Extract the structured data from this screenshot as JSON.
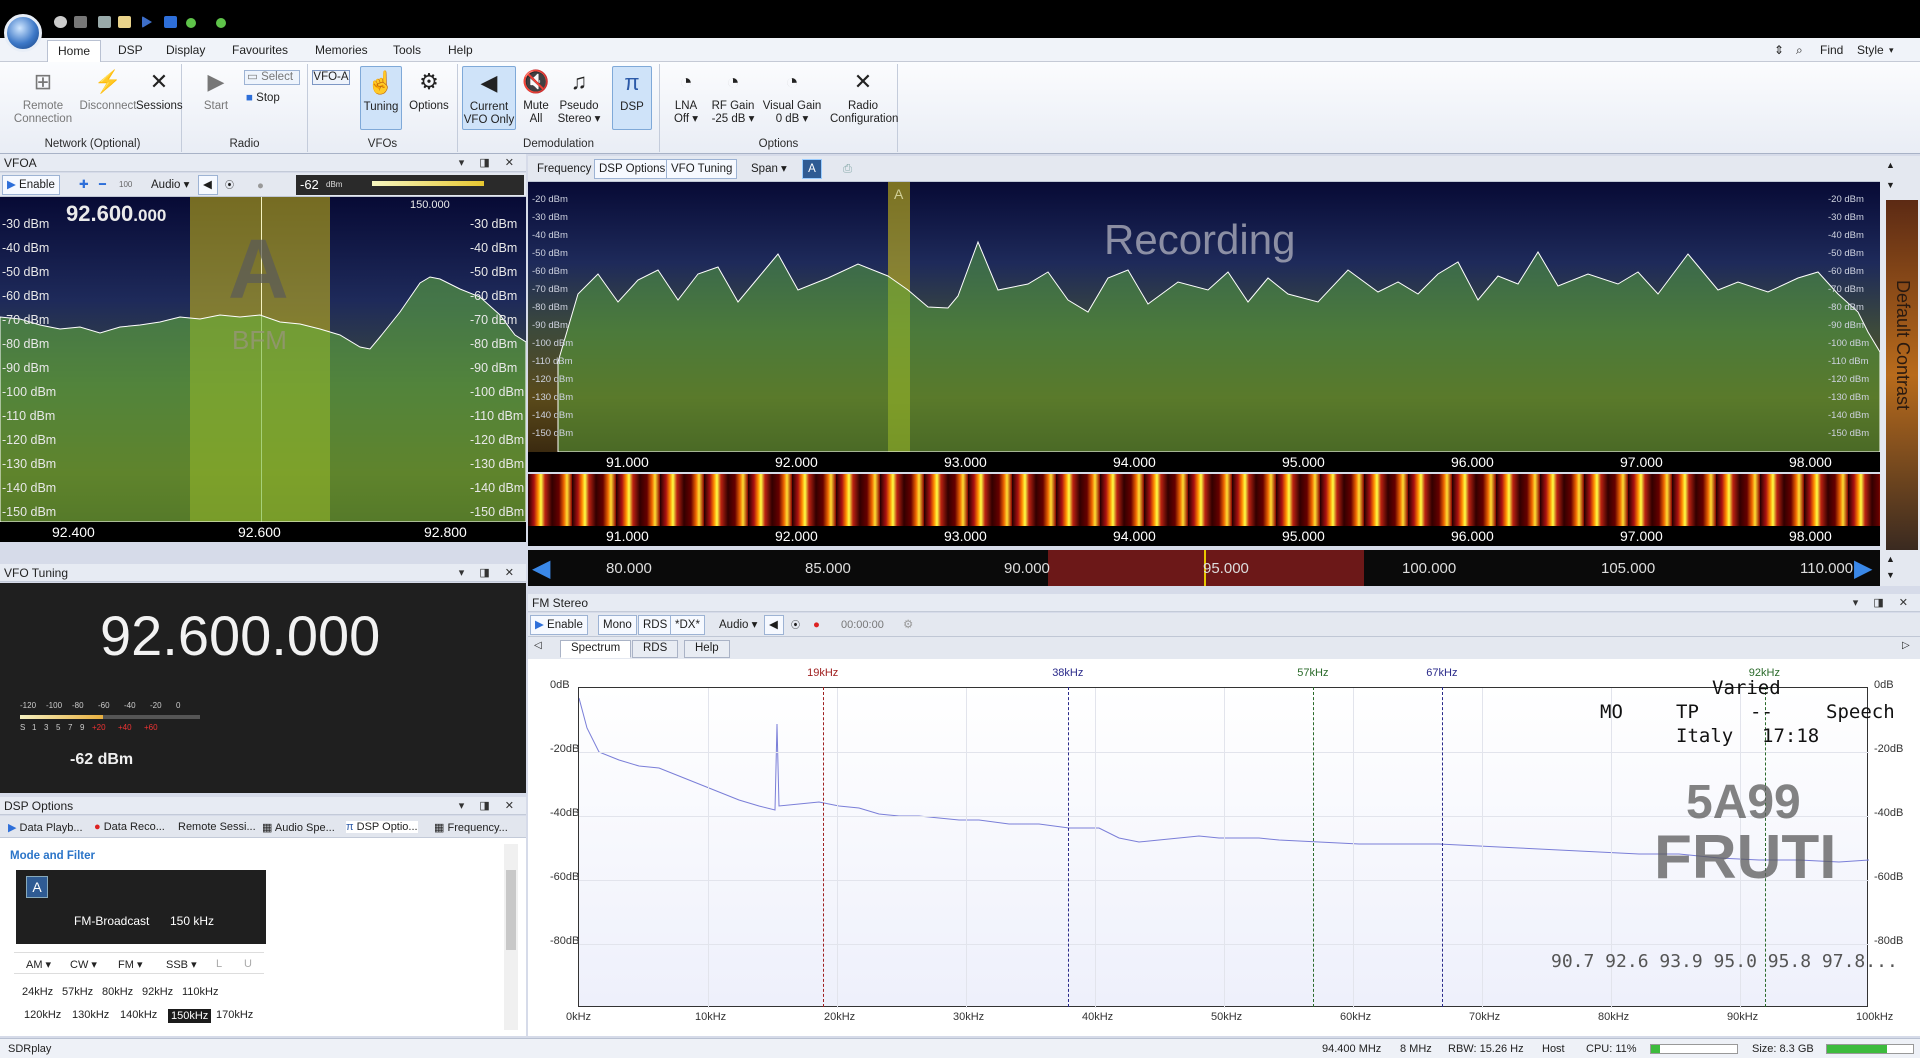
{
  "app": {
    "status_left": "SDRplay"
  },
  "menu": {
    "tabs": [
      "Home",
      "DSP",
      "Display",
      "Favourites",
      "Memories",
      "Tools",
      "Help"
    ],
    "right": {
      "find": "Find",
      "style": "Style"
    }
  },
  "ribbon": {
    "groups": {
      "network": {
        "label": "Network (Optional)",
        "remote": "Remote\nConnection",
        "disconnect": "Disconnect",
        "sessions": "Sessions"
      },
      "radio": {
        "label": "Radio",
        "start": "Start",
        "select": "Select",
        "stop": "Stop"
      },
      "vfos": {
        "label": "VFOs",
        "vfoa": "VFO-A",
        "tuning": "Tuning",
        "options": "Options"
      },
      "demodulation": {
        "label": "Demodulation",
        "current_vfo": "Current\nVFO Only",
        "mute_all": "Mute\nAll",
        "pseudo_stereo": "Pseudo\nStereo ▾",
        "dsp": "DSP"
      },
      "options": {
        "label": "Options",
        "lna": "LNA\nOff ▾",
        "rf_gain": "RF Gain\n-25 dB ▾",
        "visual_gain": "Visual Gain\n0 dB ▾",
        "radio_config": "Radio\nConfiguration"
      }
    }
  },
  "vfoa_panel": {
    "title": "VFOA",
    "enable": "Enable",
    "audio": "Audio",
    "step": "100",
    "meter_value": "-62",
    "meter_unit": "dBm",
    "bandwidth": "150.000",
    "frequency_big": "92.600",
    "frequency_small": ".000",
    "vfo_letter": "A",
    "mode": "BFM",
    "db_labels": [
      "-30 dBm",
      "-40 dBm",
      "-50 dBm",
      "-60 dBm",
      "-70 dBm",
      "-80 dBm",
      "-90 dBm",
      "-100 dBm",
      "-110 dBm",
      "-120 dBm",
      "-130 dBm",
      "-140 dBm",
      "-150 dBm"
    ],
    "freq_axis": [
      "92.400",
      "92.600",
      "92.800"
    ]
  },
  "vfo_tuning": {
    "title": "VFO Tuning",
    "frequency": "92.600.000",
    "scale_top": [
      "-120",
      "-100",
      "-80",
      "-60",
      "-40",
      "-20",
      "0"
    ],
    "scale_bottom": [
      "S",
      "1",
      "3",
      "5",
      "7",
      "9",
      "+20",
      "+40",
      "+60"
    ],
    "level": "-62 dBm",
    "level_fraction": 0.46
  },
  "dsp_options": {
    "title": "DSP Options",
    "tabs": [
      "Data Playb...",
      "Data Reco...",
      "Remote Sessi...",
      "Audio Spe...",
      "DSP Optio...",
      "Frequency..."
    ],
    "section": "Mode and Filter",
    "vfo_letter": "A",
    "mode_name": "FM-Broadcast",
    "mode_bw": "150 kHz",
    "modes": [
      "AM ▾",
      "CW ▾",
      "FM ▾",
      "SSB ▾",
      "L",
      "U"
    ],
    "bw_row1": [
      "24kHz",
      "57kHz",
      "80kHz",
      "92kHz",
      "110kHz"
    ],
    "bw_row2": [
      "120kHz",
      "130kHz",
      "140kHz",
      "150kHz",
      "170kHz"
    ],
    "bw_selected": "150kHz"
  },
  "main_spectrum": {
    "tabs": [
      "Frequency",
      "DSP Options",
      "VFO Tuning",
      "Span ▾",
      "A"
    ],
    "overlay": "Recording",
    "vfo_letter": "A",
    "db_labels": [
      "-20 dBm",
      "-30 dBm",
      "-40 dBm",
      "-50 dBm",
      "-60 dBm",
      "-70 dBm",
      "-80 dBm",
      "-90 dBm",
      "-100 dBm",
      "-110 dBm",
      "-120 dBm",
      "-130 dBm",
      "-140 dBm",
      "-150 dBm"
    ],
    "freq_axis": [
      "91.000",
      "92.000",
      "93.000",
      "94.000",
      "95.000",
      "96.000",
      "97.000",
      "98.000"
    ],
    "contrast_label": "Default Contrast",
    "overview_axis": [
      "80.000",
      "85.000",
      "90.000",
      "95.000",
      "100.000",
      "105.000",
      "110.000"
    ]
  },
  "fm_stereo": {
    "title": "FM Stereo",
    "enable": "Enable",
    "mono": "Mono",
    "rds": "RDS",
    "dx": "*DX*",
    "audio": "Audio",
    "time": "00:00:00",
    "tabs": [
      "Spectrum",
      "RDS",
      "Help"
    ],
    "markers": [
      "19kHz",
      "38kHz",
      "57kHz",
      "67kHz",
      "92kHz"
    ],
    "rds_pty": "Varied",
    "rds_line2": [
      "MO",
      "TP",
      "--",
      "Speech"
    ],
    "rds_country": "Italy",
    "rds_time": "17:18",
    "ps_line1": "5A99",
    "ps_line2": "FRUTI",
    "af_list": "90.7 92.6 93.9 95.0 95.8 97.8...",
    "db_labels": [
      "0dB",
      "-20dB",
      "-40dB",
      "-60dB",
      "-80dB"
    ],
    "khz_axis": [
      "0kHz",
      "10kHz",
      "20kHz",
      "30kHz",
      "40kHz",
      "50kHz",
      "60kHz",
      "70kHz",
      "80kHz",
      "90kHz",
      "100kHz"
    ]
  },
  "status": {
    "freq": "94.400 MHz",
    "sample": "8 MHz",
    "rbw": "RBW: 15.26 Hz",
    "host": "Host",
    "cpu": "CPU: 11%",
    "cpu_fraction": 0.11,
    "size": "Size: 8.3 GB"
  }
}
